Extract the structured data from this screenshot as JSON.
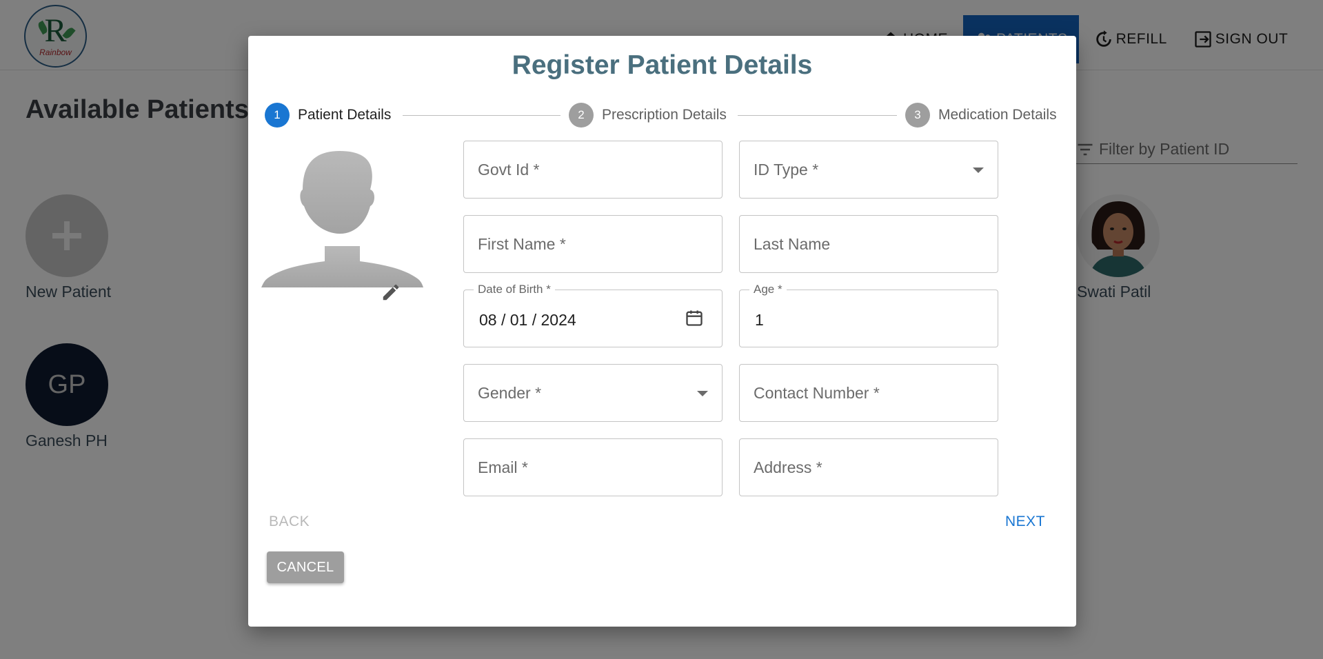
{
  "app": {
    "logo_letter": "R",
    "logo_word": "Rainbow"
  },
  "nav": {
    "items": [
      {
        "label": "HOME",
        "icon": "home-icon",
        "active": false
      },
      {
        "label": "PATIENTS",
        "icon": "patients-icon",
        "active": true
      },
      {
        "label": "REFILL",
        "icon": "refill-icon",
        "active": false
      },
      {
        "label": "SIGN OUT",
        "icon": "signout-icon",
        "active": false
      }
    ]
  },
  "page": {
    "title": "Available Patients",
    "filter_placeholder": "Filter by Patient ID"
  },
  "patients": [
    {
      "name": "New Patient",
      "icon": "plus-icon"
    },
    {
      "name": "Ganesh PH",
      "initials": "GP"
    },
    {
      "name": "Swati Patil",
      "icon": "female-avatar-icon"
    }
  ],
  "modal": {
    "title": "Register Patient Details",
    "steps": [
      {
        "number": "1",
        "label": "Patient Details",
        "active": true
      },
      {
        "number": "2",
        "label": "Prescription Details",
        "active": false
      },
      {
        "number": "3",
        "label": "Medication Details",
        "active": false
      }
    ],
    "fields": {
      "govt_id": "Govt Id *",
      "id_type": "ID Type *",
      "first_name": "First Name *",
      "last_name": "Last Name",
      "dob_label": "Date of Birth *",
      "dob_value": "08 / 01 / 2024",
      "age_label": "Age *",
      "age_value": "1",
      "gender": "Gender *",
      "contact": "Contact Number *",
      "email": "Email *",
      "address": "Address *"
    },
    "buttons": {
      "back": "BACK",
      "next": "NEXT",
      "cancel": "CANCEL"
    }
  },
  "colors": {
    "accent": "#1976d2",
    "title": "#4a6f7e",
    "overlay": "rgba(0,0,0,0.5)"
  }
}
